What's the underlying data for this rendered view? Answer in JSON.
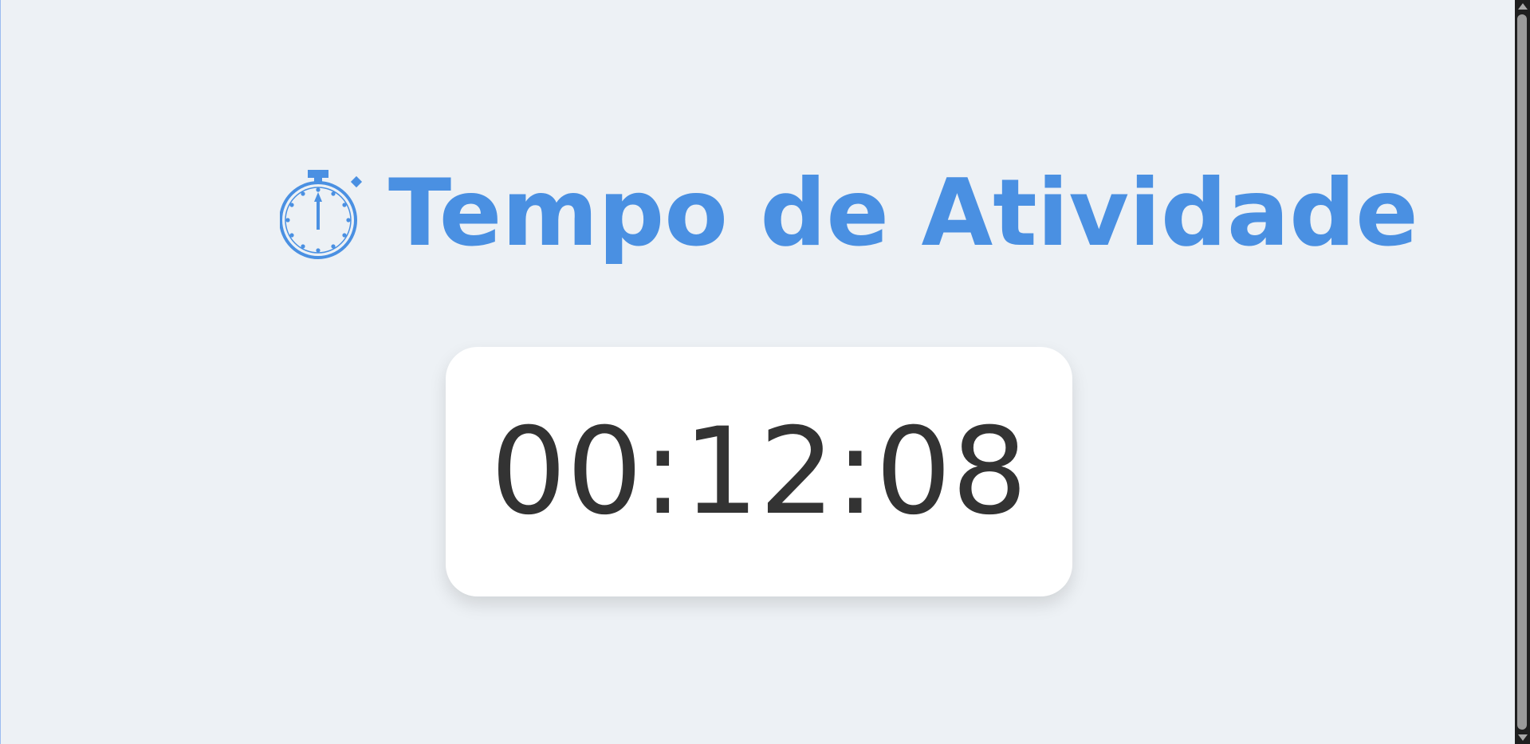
{
  "header": {
    "icon": "stopwatch-icon",
    "title": "Tempo de Atividade"
  },
  "timer": {
    "value": "00:12:08"
  },
  "colors": {
    "background": "#edf1f5",
    "accent": "#4a90e2",
    "card": "#ffffff",
    "timer_text": "#333333",
    "scrollbar": "#1f1f1f"
  },
  "scrollbar": {
    "up_icon": "scroll-up-arrow-icon",
    "down_icon": "scroll-down-arrow-icon"
  }
}
